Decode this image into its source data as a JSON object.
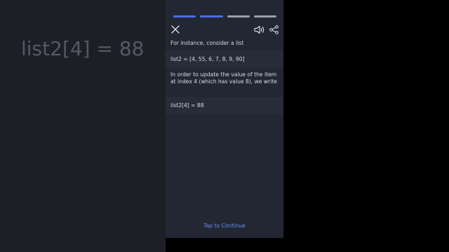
{
  "background": {
    "code_text": "list2[4] = 88"
  },
  "progress": {
    "segments": [
      {
        "state": "complete",
        "color": "#4d6ce6"
      },
      {
        "state": "complete",
        "color": "#4d6ce6"
      },
      {
        "state": "pending",
        "color": "#9aa0ad"
      },
      {
        "state": "pending",
        "color": "#9aa0ad"
      }
    ]
  },
  "toolbar": {
    "close_icon": "close-icon",
    "sound_icon": "speaker-icon",
    "share_icon": "share-icon"
  },
  "content": {
    "intro": "For instance, consider a list",
    "code_list": "list2 = [4, 55, 6, 7, 8, 9, 90]",
    "paragraph": "In order to update the value of the item at index 4 (which has value 8), we write",
    "code_update": "list2[4] = 88"
  },
  "footer": {
    "tap_label": "Tap to Continue"
  }
}
